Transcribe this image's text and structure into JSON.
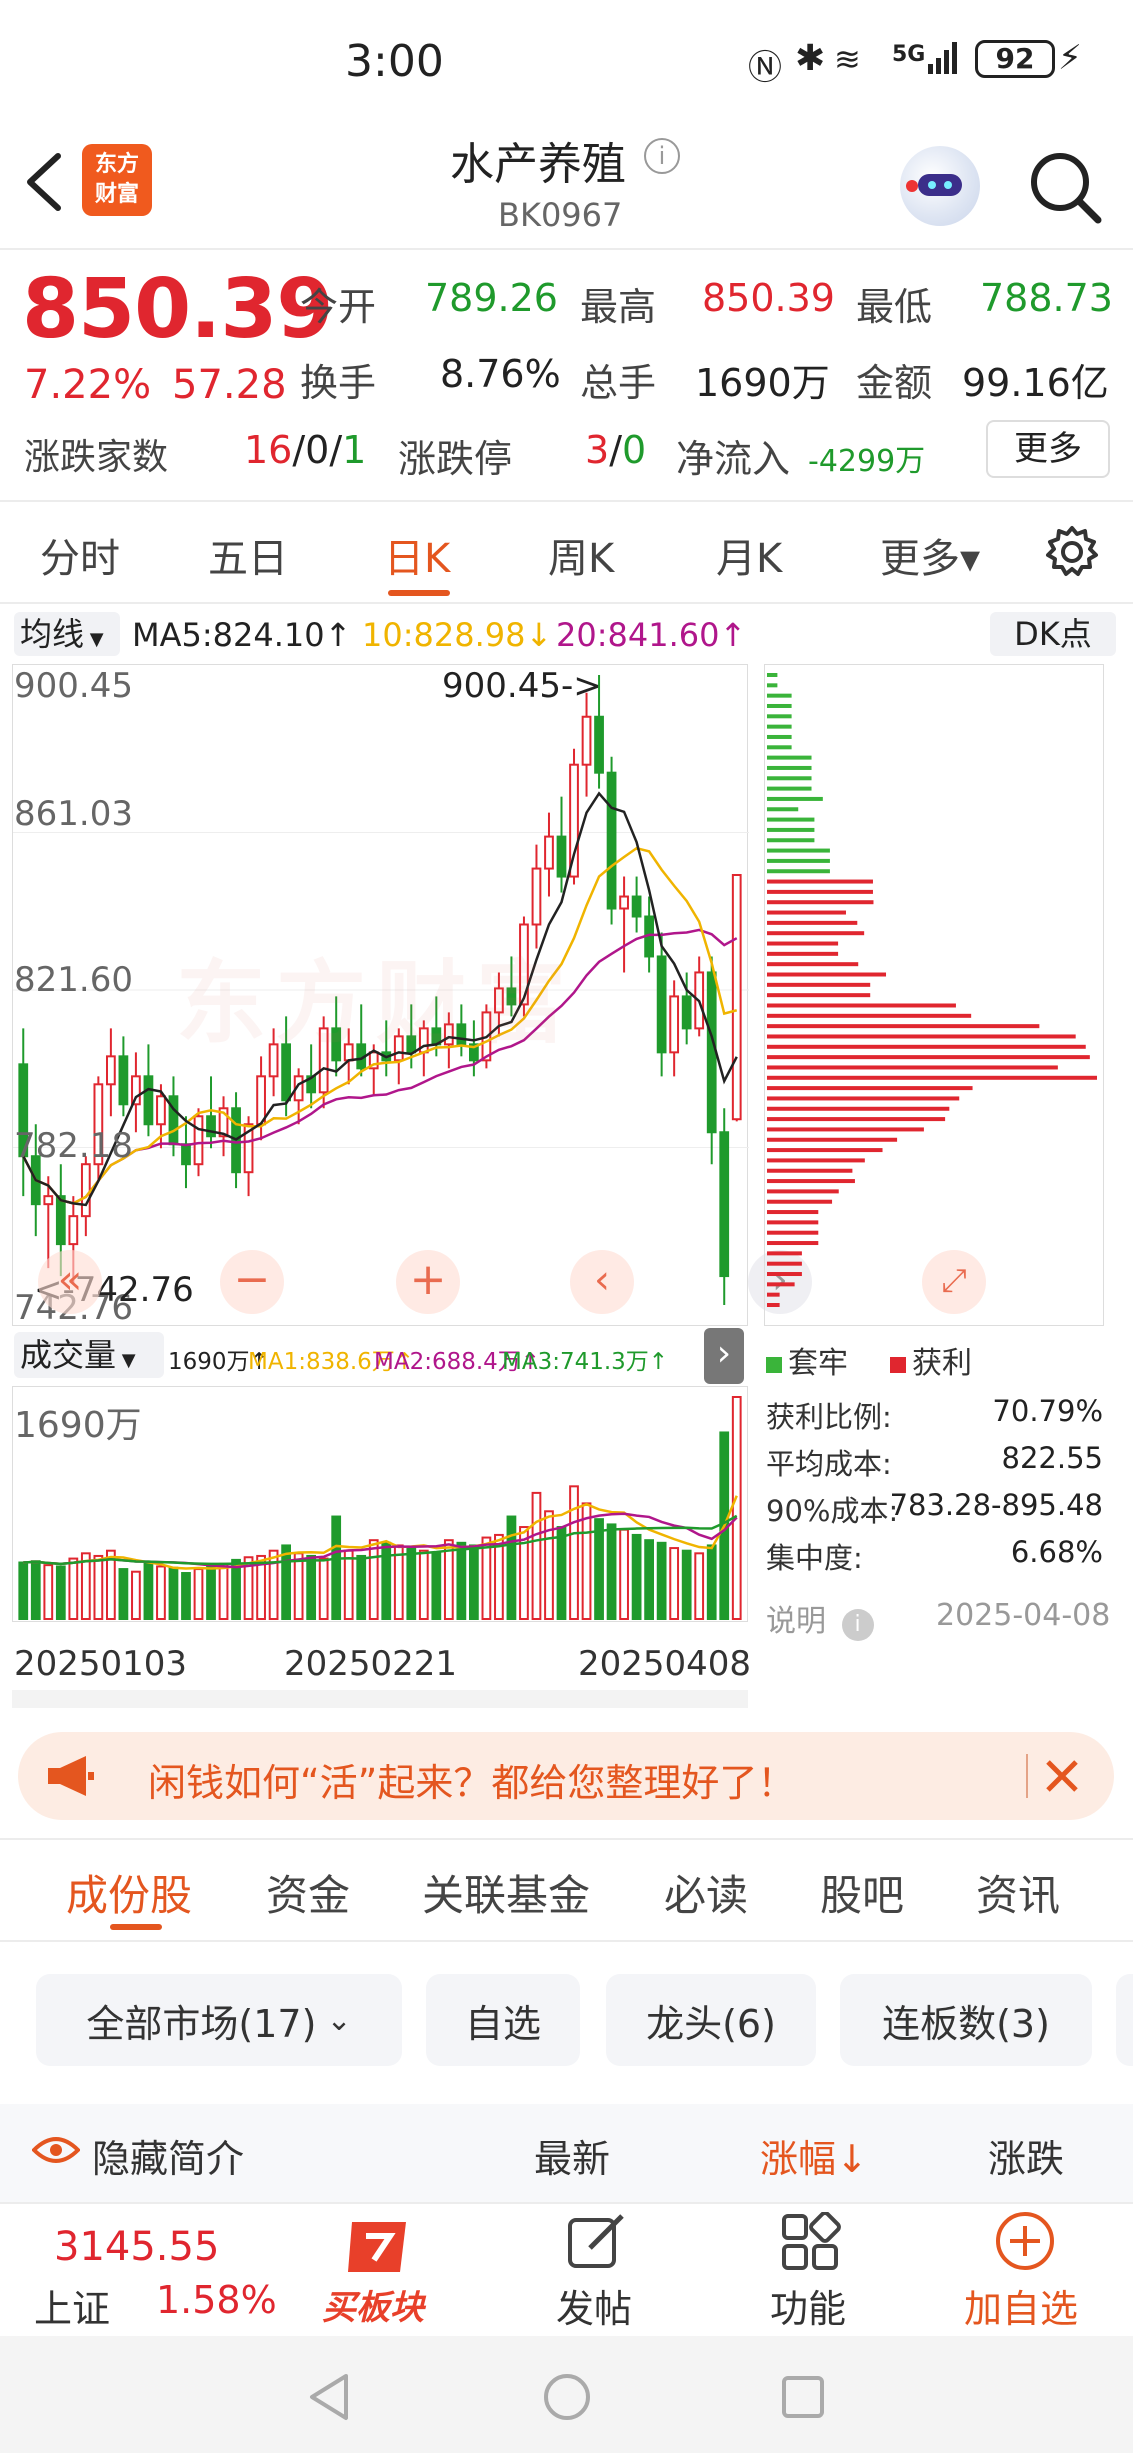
{
  "status": {
    "time": "3:00",
    "battery": "92",
    "network": "5G"
  },
  "header": {
    "back_icon": "back-arrow-icon",
    "brand_lines": [
      "东方",
      "财富"
    ],
    "title": "水产养殖",
    "code": "BK0967"
  },
  "quote": {
    "price": "850.39",
    "change_pct": "7.22%",
    "change": "57.28",
    "open_label": "今开",
    "open": "789.26",
    "high_label": "最高",
    "high": "850.39",
    "low_label": "最低",
    "low": "788.73",
    "turnover_label": "换手",
    "turnover": "8.76%",
    "volume_label": "总手",
    "volume": "1690万",
    "amount_label": "金额",
    "amount": "99.16亿",
    "updown_label": "涨跌家数",
    "up": "16",
    "flat": "0",
    "down": "1",
    "sep": "/",
    "limit_label": "涨跌停",
    "limit_up": "3",
    "limit_down": "0",
    "inflow_label": "净流入",
    "inflow": "-4299万",
    "more": "更多"
  },
  "period_tabs": [
    {
      "label": "分时"
    },
    {
      "label": "五日"
    },
    {
      "label": "日K"
    },
    {
      "label": "周K"
    },
    {
      "label": "月K"
    },
    {
      "label": "更多▾"
    }
  ],
  "ma_bar": {
    "selector": "均线",
    "ma5": "MA5:824.10↑",
    "ma10": "10:828.98↓",
    "ma20": "20:841.60↑",
    "dk": "DK点"
  },
  "kchart": {
    "y_labels": [
      "900.45",
      "861.03",
      "821.60",
      "782.18",
      "742.76"
    ],
    "max_marker": "900.45->",
    "min_marker": "<-742.76",
    "watermark": "东方财富"
  },
  "volume_bar": {
    "selector": "成交量",
    "vol": "1690万↑",
    "ma1": "MA1:838.6万↑",
    "ma2": "MA2:688.4万↑",
    "ma3": "MA3:741.3万↑"
  },
  "volchart": {
    "y_label": "1690万",
    "dates": [
      "20250103",
      "20250221",
      "20250408"
    ]
  },
  "chips": {
    "legend_trapped": "套牢",
    "legend_profit": "获利",
    "rows": [
      {
        "label": "获利比例:",
        "value": "70.79%"
      },
      {
        "label": "平均成本:",
        "value": "822.55"
      },
      {
        "label": "90%成本:",
        "value": "783.28-895.48"
      },
      {
        "label": "集中度:",
        "value": "6.68%"
      }
    ],
    "explain": "说明",
    "date": "2025-04-08"
  },
  "banner": {
    "text": "闲钱如何“活”起来？都给您整理好了！"
  },
  "section_tabs": [
    {
      "label": "成份股"
    },
    {
      "label": "资金"
    },
    {
      "label": "关联基金"
    },
    {
      "label": "必读"
    },
    {
      "label": "股吧"
    },
    {
      "label": "资讯"
    }
  ],
  "filters": [
    {
      "label": "全部市场(17)"
    },
    {
      "label": "自选"
    },
    {
      "label": "龙头(6)"
    },
    {
      "label": "连板数(3)"
    }
  ],
  "table_head": {
    "hide": "隐藏简介",
    "latest": "最新",
    "change": "涨幅↓",
    "updown": "涨跌"
  },
  "bottom_nav": {
    "index_value": "3145.55",
    "index_name": "上证",
    "index_pct": "1.58%",
    "buy": "买板块",
    "post": "发帖",
    "func": "功能",
    "add": "加自选"
  },
  "colors": {
    "red": "#e0262f",
    "green": "#1f9a2c",
    "orange": "#e4561f",
    "ma5": "#222222",
    "ma10": "#f0b400",
    "ma20": "#b0168b"
  },
  "chart_data": {
    "type": "candlestick",
    "title": "",
    "ylim": [
      742.76,
      900.45
    ],
    "max": 900.45,
    "min": 742.76,
    "ma": {
      "ma5": 824.1,
      "ma10": 828.98,
      "ma20": 841.6
    },
    "last": {
      "open": 789.26,
      "high": 850.39,
      "low": 788.73,
      "close": 850.39
    },
    "candles": [
      [
        803,
        812,
        770,
        780
      ],
      [
        780,
        788,
        760,
        768
      ],
      [
        768,
        775,
        752,
        770
      ],
      [
        770,
        778,
        750,
        758
      ],
      [
        758,
        770,
        748,
        765
      ],
      [
        765,
        780,
        760,
        778
      ],
      [
        778,
        800,
        774,
        798
      ],
      [
        798,
        812,
        790,
        805
      ],
      [
        805,
        810,
        790,
        793
      ],
      [
        793,
        806,
        786,
        800
      ],
      [
        800,
        808,
        785,
        788
      ],
      [
        788,
        798,
        782,
        795
      ],
      [
        795,
        800,
        780,
        783
      ],
      [
        783,
        790,
        772,
        778
      ],
      [
        778,
        792,
        775,
        790
      ],
      [
        790,
        800,
        782,
        785
      ],
      [
        785,
        795,
        780,
        792
      ],
      [
        792,
        796,
        772,
        776
      ],
      [
        776,
        790,
        770,
        788
      ],
      [
        788,
        805,
        784,
        800
      ],
      [
        800,
        812,
        795,
        808
      ],
      [
        808,
        815,
        790,
        794
      ],
      [
        794,
        802,
        788,
        800
      ],
      [
        800,
        808,
        792,
        796
      ],
      [
        796,
        815,
        792,
        812
      ],
      [
        812,
        820,
        800,
        804
      ],
      [
        804,
        812,
        798,
        808
      ],
      [
        808,
        818,
        800,
        802
      ],
      [
        802,
        808,
        795,
        806
      ],
      [
        806,
        814,
        800,
        804
      ],
      [
        804,
        812,
        798,
        810
      ],
      [
        810,
        818,
        802,
        806
      ],
      [
        806,
        814,
        800,
        812
      ],
      [
        812,
        820,
        805,
        808
      ],
      [
        808,
        816,
        802,
        813
      ],
      [
        813,
        818,
        805,
        808
      ],
      [
        808,
        814,
        800,
        804
      ],
      [
        804,
        818,
        802,
        816
      ],
      [
        816,
        826,
        810,
        822
      ],
      [
        822,
        830,
        815,
        818
      ],
      [
        818,
        840,
        815,
        838
      ],
      [
        838,
        858,
        832,
        852
      ],
      [
        852,
        866,
        845,
        860
      ],
      [
        860,
        870,
        846,
        850
      ],
      [
        850,
        882,
        848,
        878
      ],
      [
        878,
        896,
        870,
        890
      ],
      [
        890,
        900.45,
        872,
        876
      ],
      [
        876,
        880,
        838,
        842
      ],
      [
        842,
        850,
        826,
        845
      ],
      [
        845,
        850,
        836,
        840
      ],
      [
        840,
        845,
        826,
        830
      ],
      [
        830,
        836,
        800,
        806
      ],
      [
        806,
        824,
        800,
        820
      ],
      [
        820,
        826,
        808,
        812
      ],
      [
        812,
        830,
        810,
        826
      ],
      [
        826,
        830,
        778,
        786
      ],
      [
        786,
        792,
        742.76,
        750
      ],
      [
        789.26,
        850.39,
        788.73,
        850.39
      ]
    ],
    "volume": [
      430,
      440,
      410,
      400,
      460,
      500,
      480,
      520,
      380,
      360,
      420,
      400,
      390,
      350,
      380,
      400,
      420,
      450,
      470,
      480,
      520,
      560,
      500,
      480,
      460,
      780,
      520,
      480,
      600,
      580,
      560,
      540,
      520,
      500,
      600,
      580,
      560,
      620,
      640,
      780,
      700,
      960,
      820,
      700,
      1010,
      880,
      760,
      720,
      680,
      640,
      600,
      580,
      540,
      520,
      500,
      560,
      1420,
      1690
    ]
  }
}
